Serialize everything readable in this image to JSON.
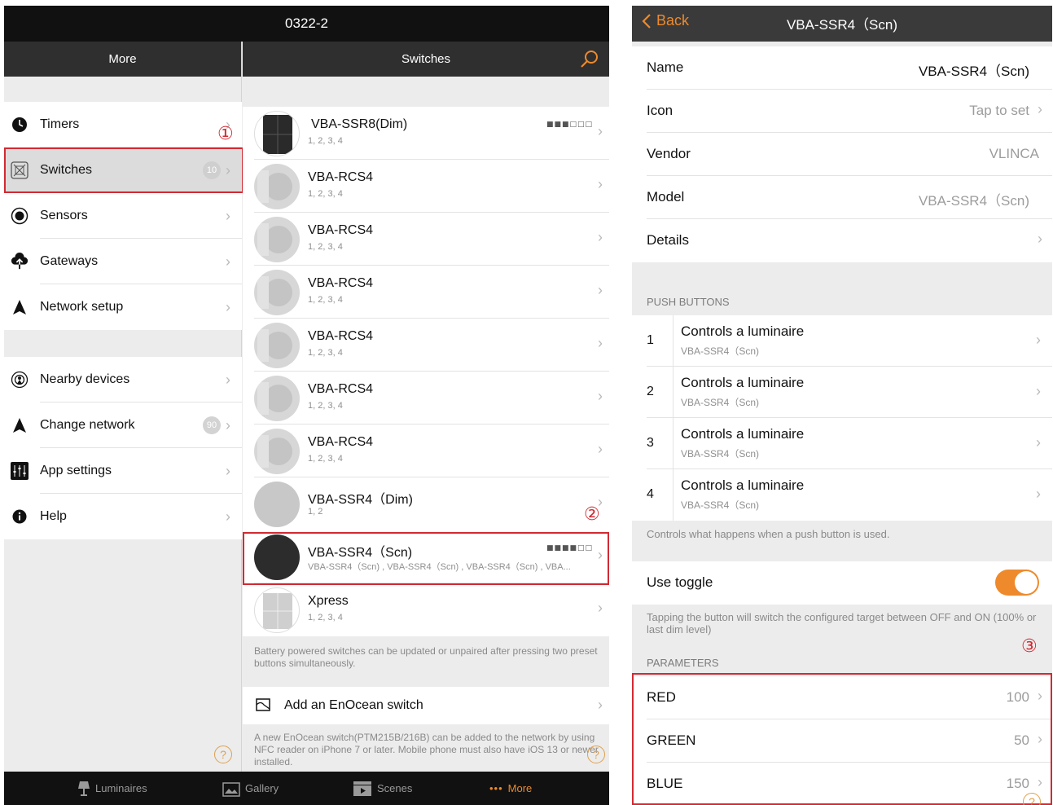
{
  "left": {
    "title": "0322-2",
    "more": {
      "header": "More",
      "items": [
        {
          "label": "Timers",
          "icon": "clock-icon"
        },
        {
          "label": "Switches",
          "icon": "switch-icon",
          "badge": "10"
        },
        {
          "label": "Sensors",
          "icon": "sensor-icon"
        },
        {
          "label": "Gateways",
          "icon": "cloud-upload-icon"
        },
        {
          "label": "Network setup",
          "icon": "navigation-arrow-icon"
        }
      ],
      "items2": [
        {
          "label": "Nearby devices",
          "icon": "broadcast-icon"
        },
        {
          "label": "Change network",
          "icon": "navigation-arrow-icon",
          "badge": "90"
        },
        {
          "label": "App settings",
          "icon": "sliders-icon"
        },
        {
          "label": "Help",
          "icon": "info-icon"
        }
      ],
      "annotation": "①"
    },
    "switches": {
      "header": "Switches",
      "list": [
        {
          "name": "VBA-SSR8(Dim)",
          "sub": "1, 2, 3, 4",
          "signal": "■■■□□□"
        },
        {
          "name": "VBA-RCS4",
          "sub": "1, 2, 3, 4"
        },
        {
          "name": "VBA-RCS4",
          "sub": "1, 2, 3, 4"
        },
        {
          "name": "VBA-RCS4",
          "sub": "1, 2, 3, 4"
        },
        {
          "name": "VBA-RCS4",
          "sub": "1, 2, 3, 4"
        },
        {
          "name": "VBA-RCS4",
          "sub": "1, 2, 3, 4"
        },
        {
          "name": "VBA-RCS4",
          "sub": "1, 2, 3, 4"
        },
        {
          "name": "VBA-SSR4（Dim)",
          "sub": "1, 2"
        },
        {
          "name": "VBA-SSR4（Scn)",
          "sub": "VBA-SSR4（Scn) , VBA-SSR4（Scn) , VBA-SSR4（Scn) , VBA...",
          "signal": "■■■■□□"
        },
        {
          "name": "Xpress",
          "sub": "1, 2, 3, 4"
        }
      ],
      "battery_note": "Battery powered switches can be updated or unpaired after pressing two preset buttons simultaneously.",
      "add_label": "Add an EnOcean switch",
      "add_note": "A new EnOcean switch(PTM215B/216B) can be added to the network by using NFC reader on iPhone 7 or later. Mobile phone must also have iOS 13 or newer installed.",
      "annotation": "②"
    },
    "tabs": [
      {
        "label": "Luminaires",
        "icon": "lamp-icon"
      },
      {
        "label": "Gallery",
        "icon": "gallery-icon"
      },
      {
        "label": "Scenes",
        "icon": "clapper-icon"
      },
      {
        "label": "More",
        "icon": "dots-icon",
        "glyph": "•••"
      }
    ]
  },
  "right": {
    "back": "Back",
    "title": "VBA-SSR4（Scn)",
    "props": [
      {
        "key": "Name",
        "value": "VBA-SSR4（Scn)"
      },
      {
        "key": "Icon",
        "value": "Tap to set"
      },
      {
        "key": "Vendor",
        "value": "VLINCA"
      },
      {
        "key": "Model",
        "value": "VBA-SSR4（Scn)"
      },
      {
        "key": "Details",
        "value": ""
      }
    ],
    "push_header": "PUSH BUTTONS",
    "buttons": [
      {
        "num": "1",
        "title": "Controls a luminaire",
        "sub": "VBA-SSR4（Scn)"
      },
      {
        "num": "2",
        "title": "Controls a luminaire",
        "sub": "VBA-SSR4（Scn)"
      },
      {
        "num": "3",
        "title": "Controls a luminaire",
        "sub": "VBA-SSR4（Scn)"
      },
      {
        "num": "4",
        "title": "Controls a luminaire",
        "sub": "VBA-SSR4（Scn)"
      }
    ],
    "push_note": "Controls what happens when a push button is used.",
    "toggle_label": "Use toggle",
    "toggle_note": "Tapping the button will switch the configured target between OFF and ON (100% or last dim level)",
    "params_header": "PARAMETERS",
    "params": [
      {
        "key": "RED",
        "value": "100"
      },
      {
        "key": "GREEN",
        "value": "50"
      },
      {
        "key": "BLUE",
        "value": "150"
      }
    ],
    "annotation": "③"
  },
  "colors": {
    "accent": "#ee8a2b",
    "annotation_red": "#d22a33"
  }
}
